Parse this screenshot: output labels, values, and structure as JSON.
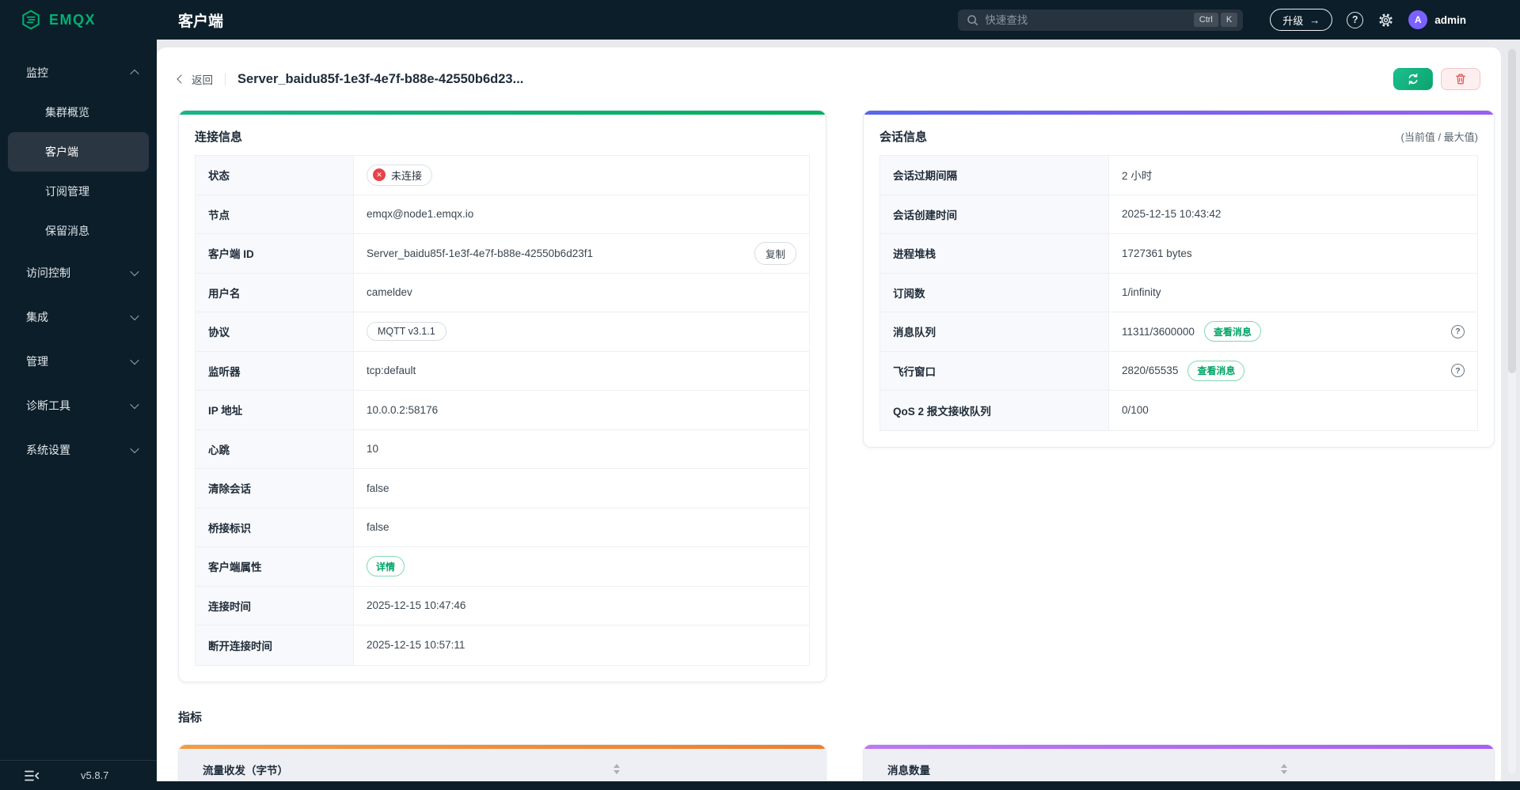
{
  "brand": {
    "name": "EMQX"
  },
  "header": {
    "page_title": "客户端",
    "search": {
      "placeholder": "快速查找",
      "keys": [
        "Ctrl",
        "K"
      ]
    },
    "upgrade": {
      "label": "升级",
      "arrow": "→"
    },
    "help_glyph": "?",
    "user": {
      "name": "admin",
      "avatar_letter": "A"
    }
  },
  "sidebar": {
    "monitor": {
      "label": "监控",
      "items": [
        {
          "label": "集群概览"
        },
        {
          "label": "客户端"
        },
        {
          "label": "订阅管理"
        },
        {
          "label": "保留消息"
        }
      ]
    },
    "collapsed_groups": [
      {
        "label": "访问控制"
      },
      {
        "label": "集成"
      },
      {
        "label": "管理"
      },
      {
        "label": "诊断工具"
      },
      {
        "label": "系统设置"
      }
    ],
    "version": "v5.8.7"
  },
  "toolbar": {
    "back_label": "返回",
    "client_title": "Server_baidu85f-1e3f-4e7f-b88e-42550b6d23..."
  },
  "connection_card": {
    "title": "连接信息",
    "rows": {
      "status": {
        "label": "状态",
        "badge": "未连接",
        "badge_icon": "✕"
      },
      "node": {
        "label": "节点",
        "value": "emqx@node1.emqx.io"
      },
      "client_id": {
        "label": "客户端 ID",
        "value": "Server_baidu85f-1e3f-4e7f-b88e-42550b6d23f1",
        "copy_label": "复制"
      },
      "username": {
        "label": "用户名",
        "value": "cameldev"
      },
      "protocol": {
        "label": "协议",
        "tag": "MQTT v3.1.1"
      },
      "listener": {
        "label": "监听器",
        "value": "tcp:default"
      },
      "ip": {
        "label": "IP 地址",
        "value": "10.0.0.2:58176"
      },
      "keepalive": {
        "label": "心跳",
        "value": "10"
      },
      "clean_session": {
        "label": "清除会话",
        "value": "false"
      },
      "bridge_flag": {
        "label": "桥接标识",
        "value": "false"
      },
      "client_attrs": {
        "label": "客户端属性",
        "button": "详情"
      },
      "connected_at": {
        "label": "连接时间",
        "value": "2025-12-15 10:47:46"
      },
      "disconnected_at": {
        "label": "断开连接时间",
        "value": "2025-12-15 10:57:11"
      }
    }
  },
  "session_card": {
    "title": "会话信息",
    "note": "(当前值 / 最大值)",
    "help_glyph": "?",
    "rows": {
      "expiry": {
        "label": "会话过期间隔",
        "value": "2 小时"
      },
      "created": {
        "label": "会话创建时间",
        "value": "2025-12-15 10:43:42"
      },
      "heap": {
        "label": "进程堆栈",
        "value": "1727361 bytes"
      },
      "subscriptions": {
        "label": "订阅数",
        "value": "1/infinity"
      },
      "message_queue": {
        "label": "消息队列",
        "value": "11311/3600000",
        "button": "查看消息"
      },
      "inflight": {
        "label": "飞行窗口",
        "value": "2820/65535",
        "button": "查看消息"
      },
      "qos2_queue": {
        "label": "QoS 2 报文接收队列",
        "value": "0/100"
      }
    }
  },
  "metrics": {
    "title": "指标",
    "traffic_chart": {
      "title": "流量收发（字节）"
    },
    "messages_chart": {
      "title": "消息数量"
    }
  },
  "colors": {
    "brand_green": "#00b173",
    "avatar_purple": "#7b61ff",
    "status_error": "#e7434a",
    "connection_accent_from": "#16b487",
    "connection_accent_to": "#00af5b",
    "session_accent_from": "#5a65ee",
    "session_accent_to": "#9a5ff2",
    "traffic_accent_from": "#f49b45",
    "traffic_accent_to": "#ee7f2e",
    "messages_accent_from": "#c077f2",
    "messages_accent_to": "#a95ef0"
  }
}
